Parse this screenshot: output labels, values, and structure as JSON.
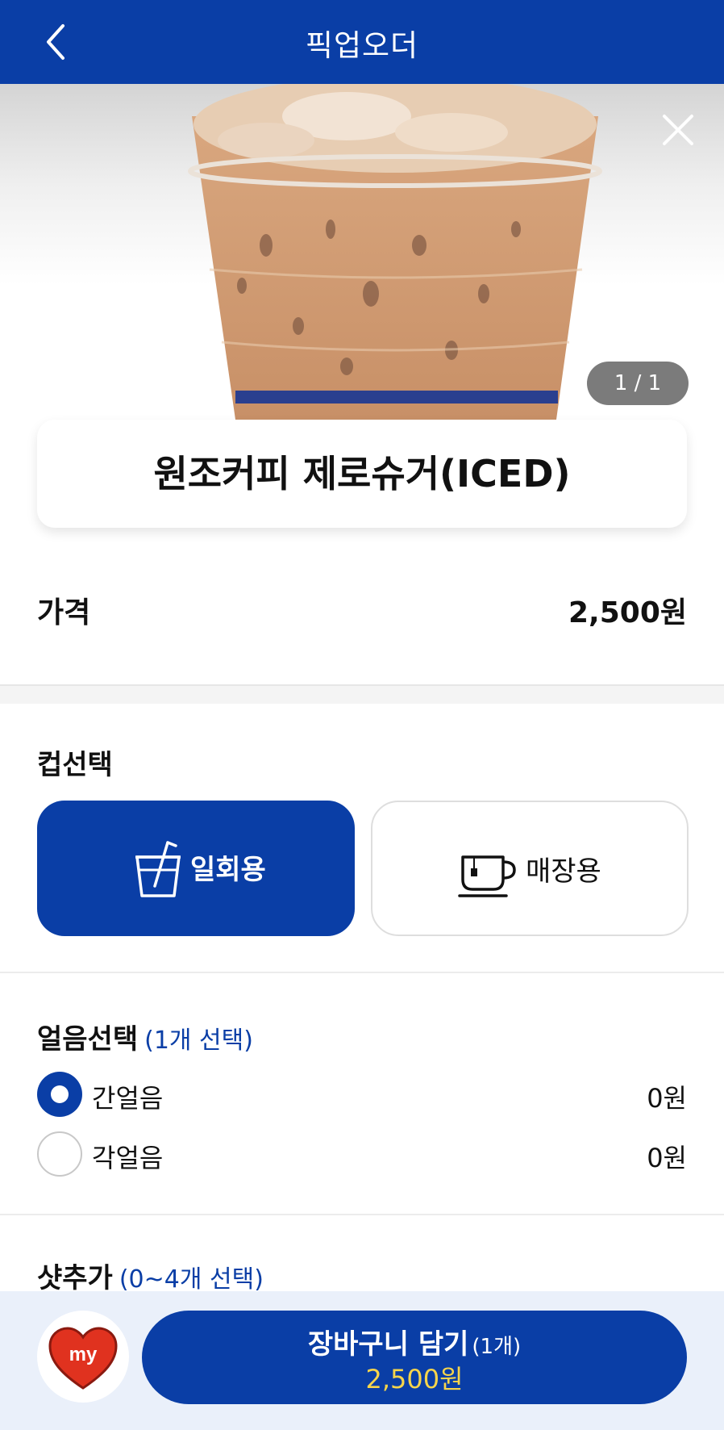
{
  "header": {
    "title": "픽업오더"
  },
  "hero": {
    "counter": "1 / 1"
  },
  "product": {
    "name": "원조커피 제로슈거(ICED)"
  },
  "price": {
    "label": "가격",
    "value": "2,500원"
  },
  "cup": {
    "title": "컵선택",
    "options": [
      {
        "label": "일회용",
        "icon": "plastic-cup-icon",
        "selected": true
      },
      {
        "label": "매장용",
        "icon": "mug-icon",
        "selected": false
      }
    ]
  },
  "ice": {
    "title": "얼음선택",
    "hint": "(1개 선택)",
    "options": [
      {
        "label": "간얼음",
        "price": "0원",
        "selected": true
      },
      {
        "label": "각얼음",
        "price": "0원",
        "selected": false
      }
    ]
  },
  "shot": {
    "title": "샷추가",
    "hint": "(0~4개 선택)"
  },
  "footer": {
    "my_label": "my",
    "cart_label": "장바구니 담기",
    "cart_qty": "(1개)",
    "cart_total": "2,500원"
  },
  "colors": {
    "primary": "#0a3ea6",
    "accent_yellow": "#f7d54b",
    "heart_red": "#e0321f"
  }
}
